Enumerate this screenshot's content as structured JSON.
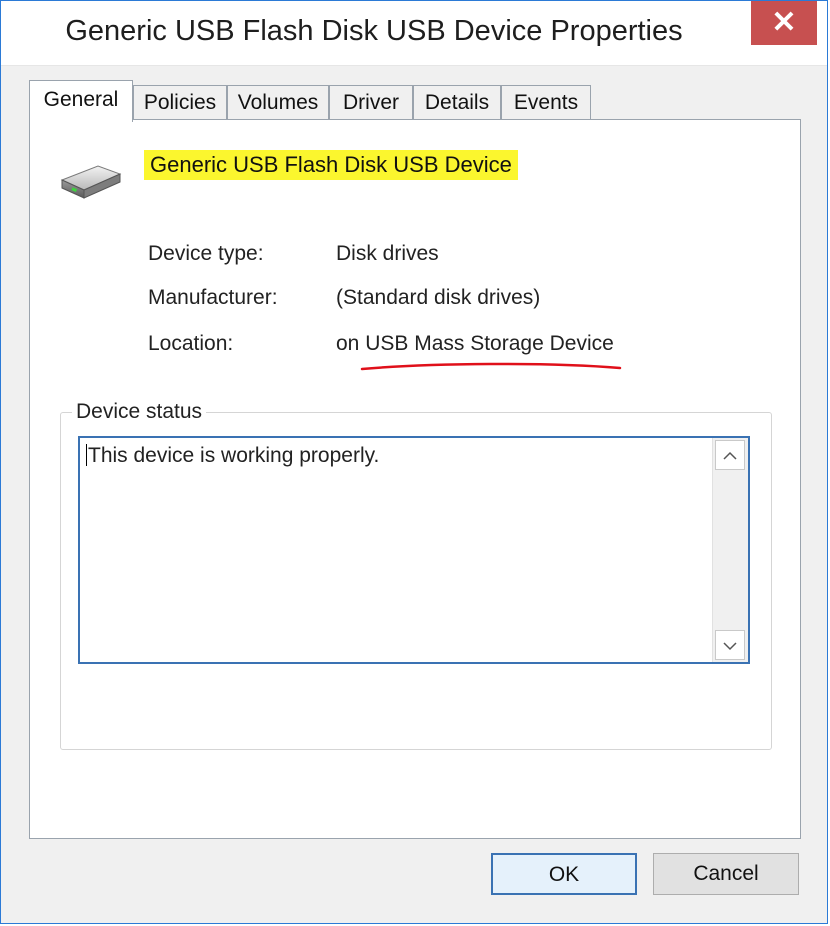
{
  "window": {
    "title": "Generic USB Flash Disk USB Device Properties",
    "close_glyph": "✕"
  },
  "tabs": [
    {
      "label": "General",
      "active": true
    },
    {
      "label": "Policies"
    },
    {
      "label": "Volumes"
    },
    {
      "label": "Driver"
    },
    {
      "label": "Details"
    },
    {
      "label": "Events"
    }
  ],
  "general": {
    "device_name": "Generic USB Flash Disk USB Device",
    "device_icon": "usb-drive-icon",
    "properties": [
      {
        "label": "Device type:",
        "value": "Disk drives"
      },
      {
        "label": "Manufacturer:",
        "value": "(Standard disk drives)"
      },
      {
        "label": "Location:",
        "value": "on USB Mass Storage Device"
      }
    ],
    "status_group_label": "Device status",
    "status_text": "This device is working properly."
  },
  "buttons": {
    "ok": "OK",
    "cancel": "Cancel"
  },
  "colors": {
    "highlight": "#fbf62e",
    "annotation_underline": "#e0101a",
    "close_button": "#c75050",
    "focus_border": "#3a72b3"
  }
}
